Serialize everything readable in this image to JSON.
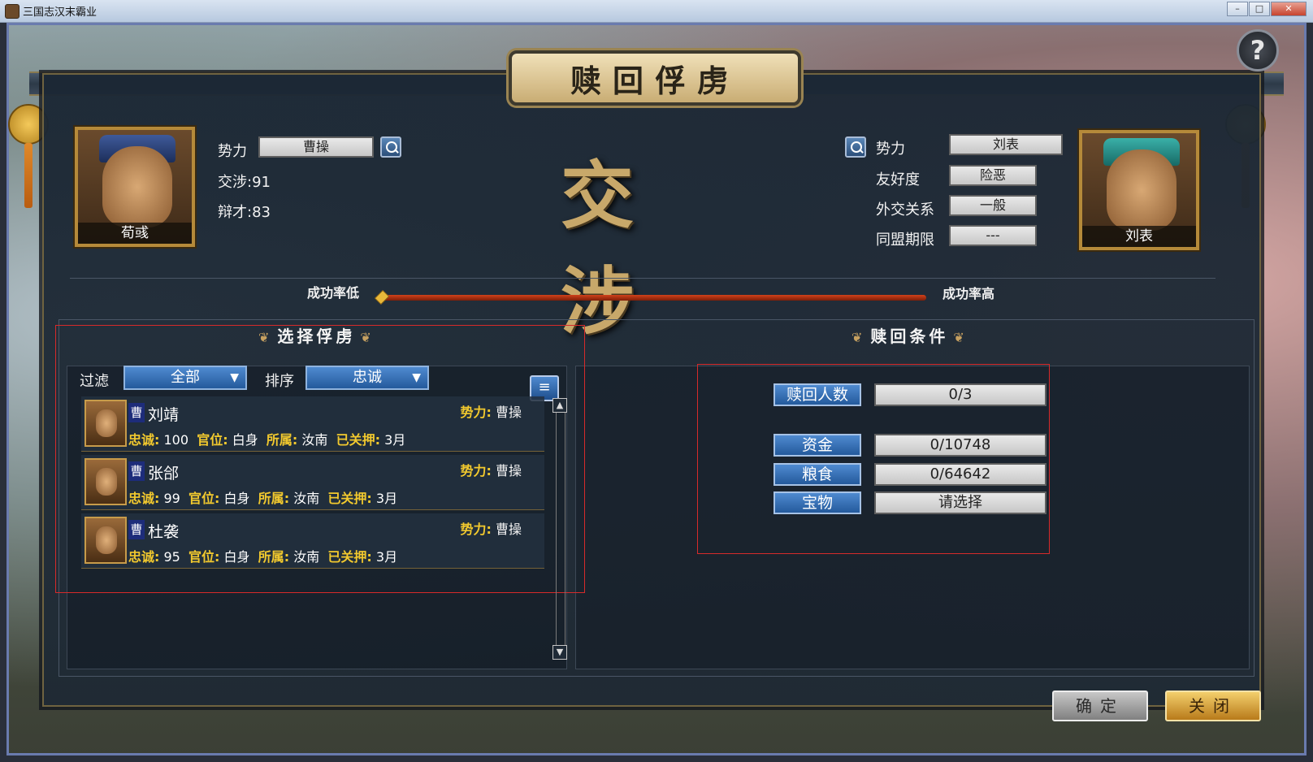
{
  "window": {
    "title": "三国志汉末霸业",
    "minimize": "–",
    "maximize": "□",
    "close": "✕"
  },
  "dialog_title": "赎回俘虏",
  "help_label": "?",
  "left_officer": {
    "name": "荀彧",
    "force_label": "势力",
    "force": "曹操",
    "negotiation": "交涉:91",
    "eloquence": "辩才:83"
  },
  "center_title": "交涉",
  "right_officer": {
    "name": "刘表",
    "force_label": "势力",
    "force": "刘表",
    "friendship_label": "友好度",
    "friendship": "险恶",
    "diplomacy_label": "外交关系",
    "diplomacy": "一般",
    "alliance_label": "同盟期限",
    "alliance": "---"
  },
  "success_rate": {
    "low": "成功率低",
    "high": "成功率高",
    "value": 0
  },
  "select_section": {
    "title": "选择俘虏",
    "filter_label": "过滤",
    "filter_value": "全部",
    "sort_label": "排序",
    "sort_value": "忠诚",
    "list_icon": "≡"
  },
  "captives": [
    {
      "tag": "曹",
      "name": "刘靖",
      "force_label": "势力:",
      "force": "曹操",
      "loyalty_label": "忠诚:",
      "loyalty": "100",
      "rank_label": "官位:",
      "rank": "白身",
      "belong_label": "所属:",
      "belong": "汝南",
      "held_label": "已关押:",
      "held": "3月"
    },
    {
      "tag": "曹",
      "name": "张郃",
      "force_label": "势力:",
      "force": "曹操",
      "loyalty_label": "忠诚:",
      "loyalty": "99",
      "rank_label": "官位:",
      "rank": "白身",
      "belong_label": "所属:",
      "belong": "汝南",
      "held_label": "已关押:",
      "held": "3月"
    },
    {
      "tag": "曹",
      "name": "杜袭",
      "force_label": "势力:",
      "force": "曹操",
      "loyalty_label": "忠诚:",
      "loyalty": "95",
      "rank_label": "官位:",
      "rank": "白身",
      "belong_label": "所属:",
      "belong": "汝南",
      "held_label": "已关押:",
      "held": "3月"
    }
  ],
  "conditions": {
    "title": "赎回条件",
    "count_label": "赎回人数",
    "count_value": "0/3",
    "gold_label": "资金",
    "gold_value": "0/10748",
    "food_label": "粮食",
    "food_value": "0/64642",
    "treasure_label": "宝物",
    "treasure_value": "请选择"
  },
  "buttons": {
    "confirm": "确定",
    "close": "关闭"
  }
}
